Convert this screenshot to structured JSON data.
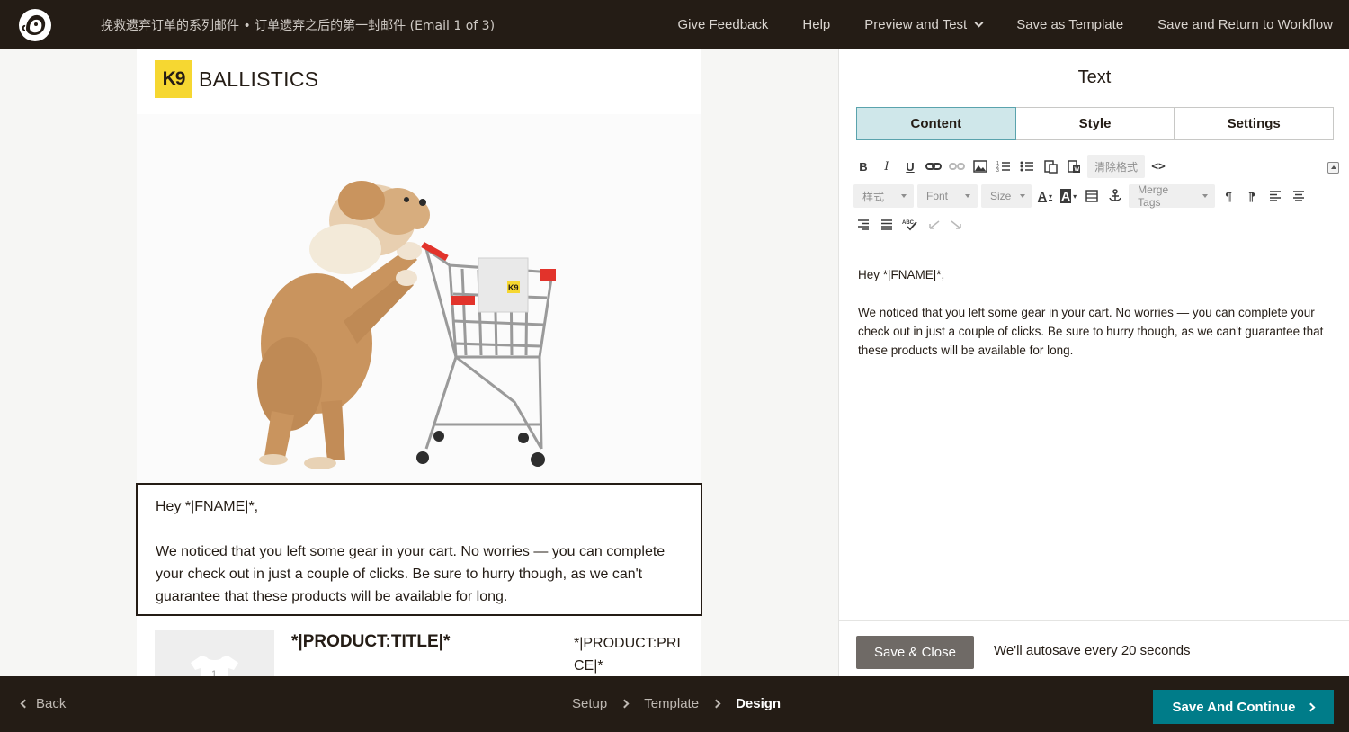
{
  "header": {
    "title": "挽救遗弃订单的系列邮件 • 订单遗弃之后的第一封邮件 (Email 1 of 3)",
    "nav": {
      "feedback": "Give Feedback",
      "help": "Help",
      "preview": "Preview and Test",
      "save_template": "Save as Template",
      "save_return": "Save and Return to Workflow"
    }
  },
  "email": {
    "brand_mark": "K9",
    "brand_name": "BALLISTICS",
    "cart_label": "K9",
    "greeting": "Hey *|FNAME|*,",
    "body": "We noticed that you left some gear in your cart. No worries — you can complete your check out in just a couple of clicks. Be sure to hurry though, as we can't guarantee that these products will be available for long.",
    "product_title": "*|PRODUCT:TITLE|*",
    "product_price": "*|PRODUCT:PRICE|*",
    "thumb_number": "1"
  },
  "editor": {
    "title": "Text",
    "tabs": [
      "Content",
      "Style",
      "Settings"
    ],
    "toolbar": {
      "clear_format": "清除格式",
      "styles": "样式",
      "font": "Font",
      "size": "Size",
      "merge_tags": "Merge Tags"
    },
    "content": {
      "greeting": "Hey *|FNAME|*,",
      "body": "We noticed that you left some gear in your cart. No worries — you can complete your check out in just a couple of clicks. Be sure to hurry though, as we can't guarantee that these products will be available for long."
    },
    "save_close": "Save & Close",
    "autosave": "We'll autosave every 20 seconds"
  },
  "footer": {
    "back": "Back",
    "steps": [
      "Setup",
      "Template",
      "Design"
    ],
    "continue": "Save And Continue"
  },
  "colors": {
    "dark": "#241c15",
    "teal": "#007c89",
    "brand_yellow": "#f6d731",
    "tab_active": "#cfe7ea"
  }
}
